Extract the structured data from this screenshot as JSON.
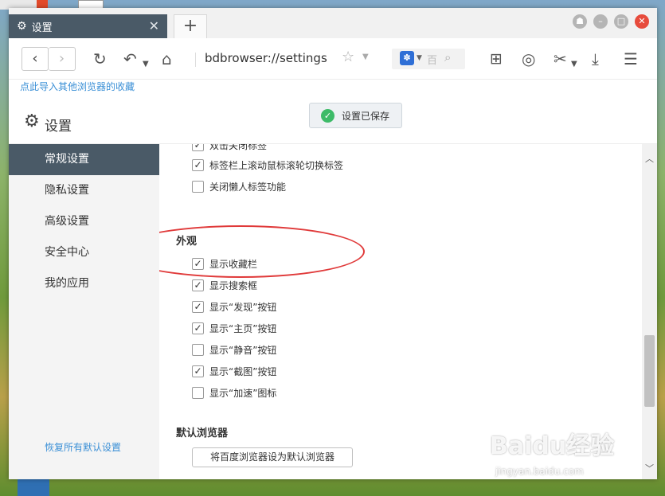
{
  "tab": {
    "title": "设置"
  },
  "toolbar": {
    "url": "bdbrowser://settings",
    "search_placeholder": "百"
  },
  "bookmarkbar": {
    "import_link": "点此导入其他浏览器的收藏"
  },
  "header": {
    "title": "设置",
    "saved_toast": "设置已保存"
  },
  "sidebar": {
    "items": [
      {
        "label": "常规设置"
      },
      {
        "label": "隐私设置"
      },
      {
        "label": "高级设置"
      },
      {
        "label": "安全中心"
      },
      {
        "label": "我的应用"
      }
    ],
    "restore_link": "恢复所有默认设置"
  },
  "content": {
    "top_options": [
      {
        "label": "双击关闭标签",
        "checked": true
      },
      {
        "label": "标签栏上滚动鼠标滚轮切换标签",
        "checked": true
      },
      {
        "label": "关闭懒人标签功能",
        "checked": false
      }
    ],
    "appearance": {
      "title": "外观",
      "options": [
        {
          "label": "显示收藏栏",
          "checked": true
        },
        {
          "label": "显示搜索框",
          "checked": true
        },
        {
          "label": "显示“发现”按钮",
          "checked": true
        },
        {
          "label": "显示“主页”按钮",
          "checked": true
        },
        {
          "label": "显示“静音”按钮",
          "checked": false
        },
        {
          "label": "显示“截图”按钮",
          "checked": true
        },
        {
          "label": "显示“加速”图标",
          "checked": false
        }
      ]
    },
    "default_browser": {
      "title": "默认浏览器",
      "button": "将百度浏览器设为默认浏览器"
    }
  },
  "watermark": {
    "text": "Baidu经验",
    "sub": "jingyan.baidu.com"
  },
  "colors": {
    "accent": "#4a5a67",
    "link": "#3a8fd6",
    "annotation": "#e03a3a"
  }
}
